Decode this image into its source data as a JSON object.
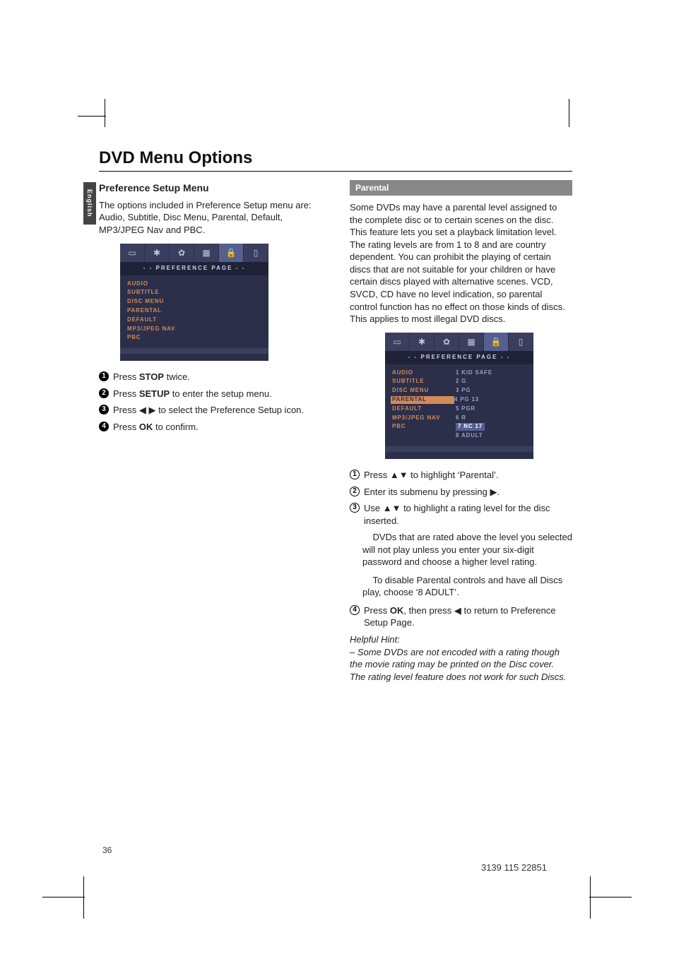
{
  "page": {
    "title": "DVD Menu Options",
    "side_tab": "English",
    "page_number": "36",
    "footer_code": "3139 115 22851"
  },
  "left_col": {
    "heading": "Preference Setup Menu",
    "intro": "The options included in Preference Setup menu are: Audio, Subtitle, Disc Menu, Parental, Default, MP3/JPEG Nav and PBC.",
    "osd": {
      "title": "- -  PREFERENCE  PAGE  - -",
      "items": [
        "AUDIO",
        "SUBTITLE",
        "DISC MENU",
        "PARENTAL",
        "DEFAULT",
        "MP3/JPEG NAV",
        "PBC"
      ]
    },
    "steps": [
      {
        "n": "1",
        "text_pre": "Press ",
        "bold": "STOP",
        "text_post": " twice."
      },
      {
        "n": "2",
        "text_pre": "Press ",
        "bold": "SETUP",
        "text_post": " to enter the setup menu."
      },
      {
        "n": "3",
        "text_pre": "Press ",
        "bold": "◀ ▶",
        "text_post": " to select the Preference Setup icon."
      },
      {
        "n": "4",
        "text_pre": "Press ",
        "bold": "OK",
        "text_post": " to confirm."
      }
    ]
  },
  "right_col": {
    "bar": "Parental",
    "intro": "Some DVDs may have a parental level assigned to the complete disc or to certain scenes on the disc.  This feature lets you set a playback limitation level. The rating levels are from 1 to 8 and are country dependent.  You can prohibit the playing of certain discs that are not suitable for your children or have certain discs played with alternative scenes. VCD, SVCD, CD have no level indication, so parental control function has no effect on those kinds of discs. This applies to most illegal DVD discs.",
    "osd": {
      "title": "- -  PREFERENCE  PAGE  - -",
      "left": [
        "AUDIO",
        "SUBTITLE",
        "DISC MENU",
        "PARENTAL",
        "DEFAULT",
        "MP3/JPEG NAV",
        "PBC"
      ],
      "right": [
        "1  KID SAFE",
        "2  G",
        "3  PG",
        "4  PG 13",
        "5  PGR",
        "6  R",
        "7  NC 17",
        "8  ADULT"
      ]
    },
    "steps": [
      {
        "n": "1",
        "style": "outline",
        "text": "Press ▲▼ to highlight ‘Parental’."
      },
      {
        "n": "2",
        "style": "outline",
        "text": "Enter its submenu by pressing ▶."
      },
      {
        "n": "3",
        "style": "outline",
        "text": "Use ▲▼ to highlight a rating level for the disc inserted."
      }
    ],
    "step3_extra1": "DVDs that are rated above the level you selected will not play unless you enter your six-digit password and choose a higher level rating.",
    "step3_extra2": "To disable Parental controls and have all Discs play, choose ‘8 ADULT’.",
    "step4": {
      "n": "4",
      "style": "outline",
      "pre": "Press ",
      "bold": "OK",
      "mid": ", then press ",
      "arrow": "◀",
      "post": " to return to Preference Setup Page."
    },
    "hint_head": "Helpful Hint:",
    "hint_body": "–  Some DVDs are not encoded with a rating though the movie rating may be printed on the Disc cover. The rating level feature does not work for such Discs."
  },
  "icons": {
    "i1": "▭",
    "i2": "✱",
    "i3": "✿",
    "i4": "▦",
    "i5": "🔒",
    "i6": "▯"
  }
}
